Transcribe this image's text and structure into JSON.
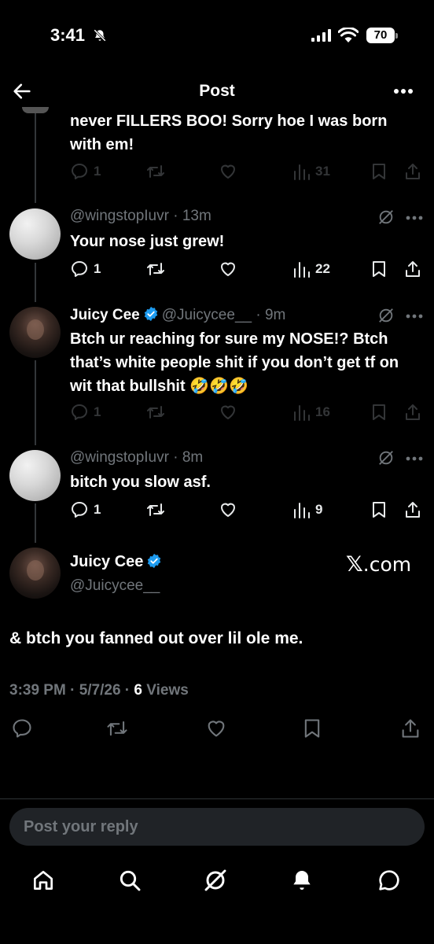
{
  "status": {
    "time": "3:41",
    "battery": "70"
  },
  "header": {
    "title": "Post"
  },
  "thread": [
    {
      "id": "partial",
      "text": "never FILLERS BOO! Sorry hoe I was born with em!",
      "replies": "1",
      "reposts": "",
      "likes": "",
      "views": "31",
      "dim": true
    },
    {
      "id": "t1",
      "name": "",
      "handle": "@wingstopIuvr",
      "time": "13m",
      "text": "Your nose just grew!",
      "replies": "1",
      "reposts": "",
      "likes": "",
      "views": "22",
      "dim": false
    },
    {
      "id": "t2",
      "name": "Juicy Cee",
      "handle": "@Juicycee__",
      "time": "9m",
      "text": "Btch ur reaching  for sure my NOSE!? Btch that’s white people shit if you don’t get tf on wit that bullshit 🤣🤣🤣",
      "replies": "1",
      "reposts": "",
      "likes": "",
      "views": "16",
      "dim": true
    },
    {
      "id": "t3",
      "name": "",
      "handle": "@wingstopIuvr",
      "time": "8m",
      "text": "bitch you slow asf.",
      "replies": "1",
      "reposts": "",
      "likes": "",
      "views": "9",
      "dim": false
    }
  ],
  "main": {
    "name": "Juicy Cee",
    "handle": "@Juicycee__",
    "watermark_prefix": "𝕏",
    "watermark_suffix": ".com",
    "text": "& btch you fanned out over lil ole me.",
    "timestamp": "3:39 PM · 5/7/26 · ",
    "views_count": "6",
    "views_label": " Views"
  },
  "reply": {
    "placeholder": "Post your reply"
  },
  "colors": {
    "verified": "#1d9bf0",
    "muted": "#71767b",
    "background": "#000000"
  }
}
